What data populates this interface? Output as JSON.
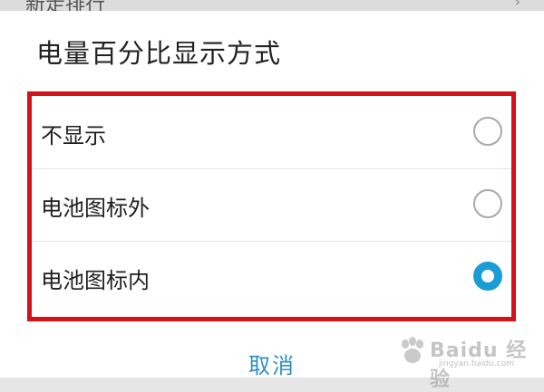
{
  "backdrop": {
    "partial_label": "新走排行",
    "chevron_icon": "chevron-right-icon"
  },
  "dialog": {
    "title": "电量百分比显示方式",
    "options": [
      {
        "label": "不显示",
        "selected": false
      },
      {
        "label": "电池图标外",
        "selected": false
      },
      {
        "label": "电池图标内",
        "selected": true
      }
    ],
    "cancel_label": "取消"
  },
  "colors": {
    "accent": "#1a9cd4",
    "highlight_border": "#d5121c",
    "cancel_text": "#2f8fc6"
  },
  "watermark": {
    "text": "Baidu 经验",
    "url": "jingyan.baidu.com"
  }
}
